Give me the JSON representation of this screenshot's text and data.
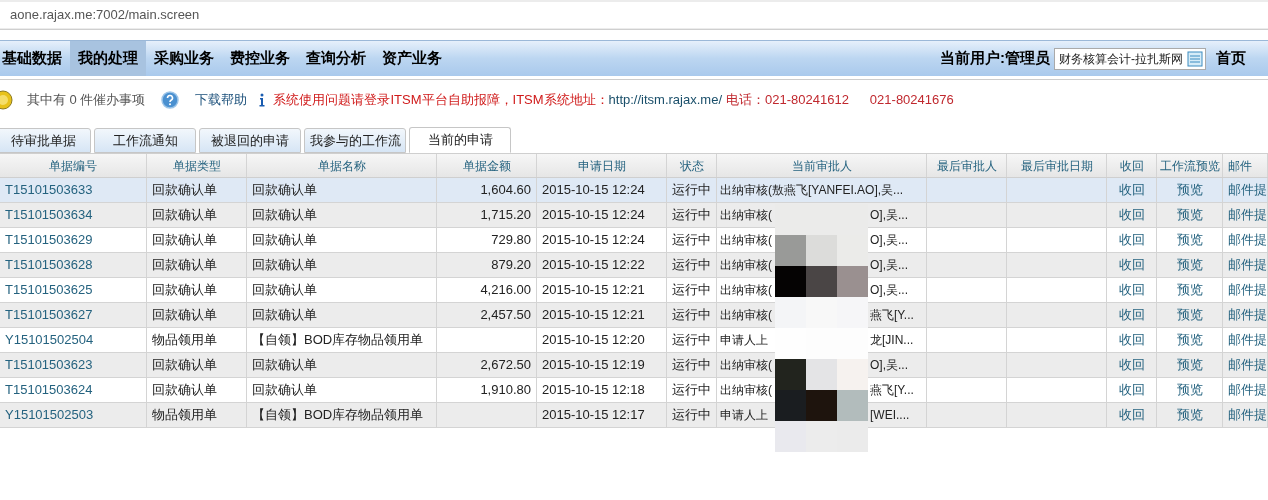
{
  "address_bar": {
    "url": "aone.rajax.me:7002/main.screen"
  },
  "nav": {
    "items": [
      {
        "label": "基础数据",
        "selected": false
      },
      {
        "label": "我的处理",
        "selected": true
      },
      {
        "label": "采购业务",
        "selected": false
      },
      {
        "label": "费控业务",
        "selected": false
      },
      {
        "label": "查询分析",
        "selected": false
      },
      {
        "label": "资产业务",
        "selected": false
      }
    ],
    "user_label": "当前用户:管理员",
    "role_field": {
      "value": "财务核算会计-拉扎斯网"
    },
    "home": "首页"
  },
  "notice": {
    "pending": "其中有 0 件催办事项",
    "help": "下载帮助",
    "message": "系统使用问题请登录ITSM平台自助报障，ITSM系统地址：",
    "url": "http://itsm.rajax.me/",
    "phone": "电话：021-80241612",
    "phone2": "021-80241676"
  },
  "tabs": [
    {
      "label": "待审批单据",
      "selected": false
    },
    {
      "label": "工作流通知",
      "selected": false
    },
    {
      "label": "被退回的申请",
      "selected": false
    },
    {
      "label": "我参与的工作流",
      "selected": false
    },
    {
      "label": "当前的申请",
      "selected": true
    }
  ],
  "table": {
    "columns": [
      "单据编号",
      "单据类型",
      "单据名称",
      "单据金额",
      "申请日期",
      "状态",
      "当前审批人",
      "最后审批人",
      "最后审批日期",
      "收回",
      "工作流预览",
      "邮件"
    ],
    "rows": [
      {
        "selected": true,
        "id": "T15101503633",
        "type": "回款确认单",
        "name": "回款确认单",
        "amount": "1,604.60",
        "date": "2015-10-15 12:24",
        "status": "运行中",
        "approver": {
          "prefix": "出纳审核(敖燕飞[YANFEI.AO],吴..."
        },
        "recall": "收回",
        "preview": "预览",
        "mail": "邮件提"
      },
      {
        "selected": false,
        "id": "T15101503634",
        "type": "回款确认单",
        "name": "回款确认单",
        "amount": "1,715.20",
        "date": "2015-10-15 12:24",
        "status": "运行中",
        "approver": {
          "prefix": "出纳审核(",
          "suffix": "O],吴..."
        },
        "recall": "收回",
        "preview": "预览",
        "mail": "邮件提"
      },
      {
        "selected": false,
        "id": "T15101503629",
        "type": "回款确认单",
        "name": "回款确认单",
        "amount": "729.80",
        "date": "2015-10-15 12:24",
        "status": "运行中",
        "approver": {
          "prefix": "出纳审核(",
          "suffix": "O],吴..."
        },
        "recall": "收回",
        "preview": "预览",
        "mail": "邮件提"
      },
      {
        "selected": false,
        "id": "T15101503628",
        "type": "回款确认单",
        "name": "回款确认单",
        "amount": "879.20",
        "date": "2015-10-15 12:22",
        "status": "运行中",
        "approver": {
          "prefix": "出纳审核(",
          "suffix": "O],吴..."
        },
        "recall": "收回",
        "preview": "预览",
        "mail": "邮件提"
      },
      {
        "selected": false,
        "id": "T15101503625",
        "type": "回款确认单",
        "name": "回款确认单",
        "amount": "4,216.00",
        "date": "2015-10-15 12:21",
        "status": "运行中",
        "approver": {
          "prefix": "出纳审核(",
          "suffix": "O],吴..."
        },
        "recall": "收回",
        "preview": "预览",
        "mail": "邮件提"
      },
      {
        "selected": false,
        "id": "T15101503627",
        "type": "回款确认单",
        "name": "回款确认单",
        "amount": "2,457.50",
        "date": "2015-10-15 12:21",
        "status": "运行中",
        "approver": {
          "prefix": "出纳审核(",
          "suffix": "燕飞[Y..."
        },
        "recall": "收回",
        "preview": "预览",
        "mail": "邮件提"
      },
      {
        "selected": false,
        "id": "Y15101502504",
        "type": "物品领用单",
        "name": "【自领】BOD库存物品领用单",
        "date": "2015-10-15 12:20",
        "status": "运行中",
        "approver": {
          "prefix": "申请人上",
          "suffix": "龙[JIN..."
        },
        "recall": "收回",
        "preview": "预览",
        "mail": "邮件提"
      },
      {
        "selected": false,
        "id": "T15101503623",
        "type": "回款确认单",
        "name": "回款确认单",
        "amount": "2,672.50",
        "date": "2015-10-15 12:19",
        "status": "运行中",
        "approver": {
          "prefix": "出纳审核(",
          "suffix": "O],吴..."
        },
        "recall": "收回",
        "preview": "预览",
        "mail": "邮件提"
      },
      {
        "selected": false,
        "id": "T15101503624",
        "type": "回款确认单",
        "name": "回款确认单",
        "amount": "1,910.80",
        "date": "2015-10-15 12:18",
        "status": "运行中",
        "approver": {
          "prefix": "出纳审核(",
          "suffix": "燕飞[Y..."
        },
        "recall": "收回",
        "preview": "预览",
        "mail": "邮件提"
      },
      {
        "selected": false,
        "id": "Y15101502503",
        "type": "物品领用单",
        "name": "【自领】BOD库存物品领用单",
        "date": "2015-10-15 12:17",
        "status": "运行中",
        "approver": {
          "prefix": "申请人上",
          "suffix": "[WEI...."
        },
        "recall": "收回",
        "preview": "预览",
        "mail": "邮件提"
      }
    ]
  }
}
